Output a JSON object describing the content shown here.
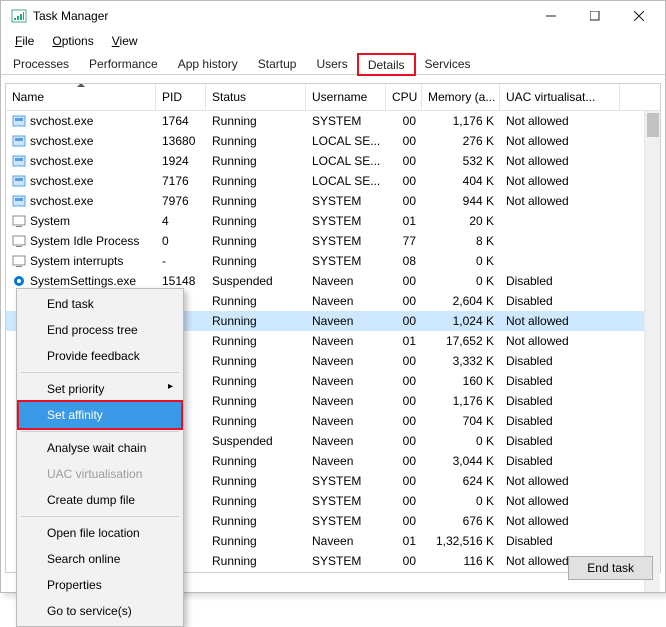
{
  "window": {
    "title": "Task Manager"
  },
  "menubar": [
    "File",
    "Options",
    "View"
  ],
  "tabs": {
    "items": [
      "Processes",
      "Performance",
      "App history",
      "Startup",
      "Users",
      "Details",
      "Services"
    ],
    "active": "Details",
    "highlighted": "Details"
  },
  "columns": [
    "Name",
    "PID",
    "Status",
    "Username",
    "CPU",
    "Memory (a...",
    "UAC virtualisat..."
  ],
  "sort_col": "Name",
  "rows": [
    {
      "name": "svchost.exe",
      "icon": "svc",
      "pid": "1764",
      "status": "Running",
      "user": "SYSTEM",
      "cpu": "00",
      "mem": "1,176 K",
      "uac": "Not allowed"
    },
    {
      "name": "svchost.exe",
      "icon": "svc",
      "pid": "13680",
      "status": "Running",
      "user": "LOCAL SE...",
      "cpu": "00",
      "mem": "276 K",
      "uac": "Not allowed"
    },
    {
      "name": "svchost.exe",
      "icon": "svc",
      "pid": "1924",
      "status": "Running",
      "user": "LOCAL SE...",
      "cpu": "00",
      "mem": "532 K",
      "uac": "Not allowed"
    },
    {
      "name": "svchost.exe",
      "icon": "svc",
      "pid": "7176",
      "status": "Running",
      "user": "LOCAL SE...",
      "cpu": "00",
      "mem": "404 K",
      "uac": "Not allowed"
    },
    {
      "name": "svchost.exe",
      "icon": "svc",
      "pid": "7976",
      "status": "Running",
      "user": "SYSTEM",
      "cpu": "00",
      "mem": "944 K",
      "uac": "Not allowed"
    },
    {
      "name": "System",
      "icon": "sys",
      "pid": "4",
      "status": "Running",
      "user": "SYSTEM",
      "cpu": "01",
      "mem": "20 K",
      "uac": ""
    },
    {
      "name": "System Idle Process",
      "icon": "sys",
      "pid": "0",
      "status": "Running",
      "user": "SYSTEM",
      "cpu": "77",
      "mem": "8 K",
      "uac": ""
    },
    {
      "name": "System interrupts",
      "icon": "sys",
      "pid": "-",
      "status": "Running",
      "user": "SYSTEM",
      "cpu": "08",
      "mem": "0 K",
      "uac": ""
    },
    {
      "name": "SystemSettings.exe",
      "icon": "gear",
      "pid": "15148",
      "status": "Suspended",
      "user": "Naveen",
      "cpu": "00",
      "mem": "0 K",
      "uac": "Disabled"
    },
    {
      "name": "",
      "icon": "",
      "pid": "",
      "status": "Running",
      "user": "Naveen",
      "cpu": "00",
      "mem": "2,604 K",
      "uac": "Disabled"
    },
    {
      "name": "",
      "icon": "",
      "pid": "",
      "status": "Running",
      "user": "Naveen",
      "cpu": "00",
      "mem": "1,024 K",
      "uac": "Not allowed",
      "sel": true
    },
    {
      "name": "",
      "icon": "",
      "pid": "",
      "status": "Running",
      "user": "Naveen",
      "cpu": "01",
      "mem": "17,652 K",
      "uac": "Not allowed"
    },
    {
      "name": "",
      "icon": "",
      "pid": "",
      "status": "Running",
      "user": "Naveen",
      "cpu": "00",
      "mem": "3,332 K",
      "uac": "Disabled"
    },
    {
      "name": "",
      "icon": "",
      "pid": "",
      "status": "Running",
      "user": "Naveen",
      "cpu": "00",
      "mem": "160 K",
      "uac": "Disabled"
    },
    {
      "name": "",
      "icon": "",
      "pid": "",
      "status": "Running",
      "user": "Naveen",
      "cpu": "00",
      "mem": "1,176 K",
      "uac": "Disabled"
    },
    {
      "name": "",
      "icon": "",
      "pid": "",
      "status": "Running",
      "user": "Naveen",
      "cpu": "00",
      "mem": "704 K",
      "uac": "Disabled"
    },
    {
      "name": "",
      "icon": "",
      "pid": "",
      "status": "Suspended",
      "user": "Naveen",
      "cpu": "00",
      "mem": "0 K",
      "uac": "Disabled"
    },
    {
      "name": "",
      "icon": "",
      "pid": "",
      "status": "Running",
      "user": "Naveen",
      "cpu": "00",
      "mem": "3,044 K",
      "uac": "Disabled"
    },
    {
      "name": "",
      "icon": "",
      "pid": "",
      "status": "Running",
      "user": "SYSTEM",
      "cpu": "00",
      "mem": "624 K",
      "uac": "Not allowed"
    },
    {
      "name": "",
      "icon": "",
      "pid": "",
      "status": "Running",
      "user": "SYSTEM",
      "cpu": "00",
      "mem": "0 K",
      "uac": "Not allowed"
    },
    {
      "name": "",
      "icon": "",
      "pid": "",
      "status": "Running",
      "user": "SYSTEM",
      "cpu": "00",
      "mem": "676 K",
      "uac": "Not allowed"
    },
    {
      "name": "",
      "icon": "",
      "pid": "",
      "status": "Running",
      "user": "Naveen",
      "cpu": "01",
      "mem": "1,32,516 K",
      "uac": "Disabled"
    },
    {
      "name": "",
      "icon": "",
      "pid": "",
      "status": "Running",
      "user": "SYSTEM",
      "cpu": "00",
      "mem": "116 K",
      "uac": "Not allowed"
    }
  ],
  "context_menu": {
    "items": [
      {
        "label": "End task"
      },
      {
        "label": "End process tree"
      },
      {
        "label": "Provide feedback"
      },
      {
        "sep": true
      },
      {
        "label": "Set priority",
        "more": true
      },
      {
        "label": "Set affinity",
        "hl": true
      },
      {
        "sep": true
      },
      {
        "label": "Analyse wait chain"
      },
      {
        "label": "UAC virtualisation",
        "disabled": true
      },
      {
        "label": "Create dump file"
      },
      {
        "sep": true
      },
      {
        "label": "Open file location"
      },
      {
        "label": "Search online"
      },
      {
        "label": "Properties"
      },
      {
        "label": "Go to service(s)"
      }
    ]
  },
  "footer": {
    "end_task": "End task"
  },
  "icons": {
    "app": "task-manager-icon"
  }
}
